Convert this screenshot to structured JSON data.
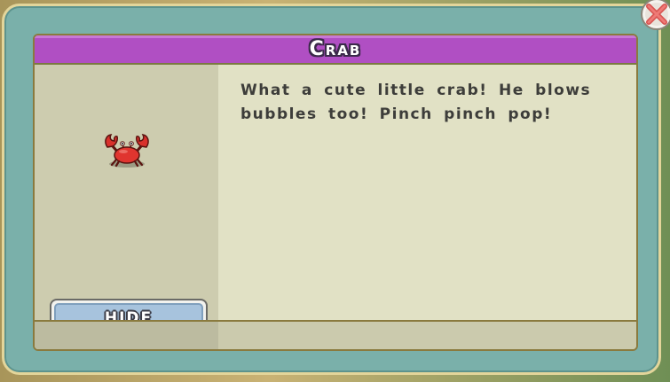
{
  "dialog": {
    "title": "Crab",
    "description": "What a cute little crab! He blows bubbles  too! Pinch pinch pop!",
    "hide_button_label": "HIDE",
    "close_icon": "close-x-icon",
    "item_icon": "crab-icon"
  },
  "colors": {
    "title_bar": "#b04fc3",
    "frame": "#7ab0aa",
    "panel": "#e1e1c5",
    "left_column": "#cdccaf",
    "hide_button": "#a7c3dd",
    "close_button": "#e26f6f"
  }
}
